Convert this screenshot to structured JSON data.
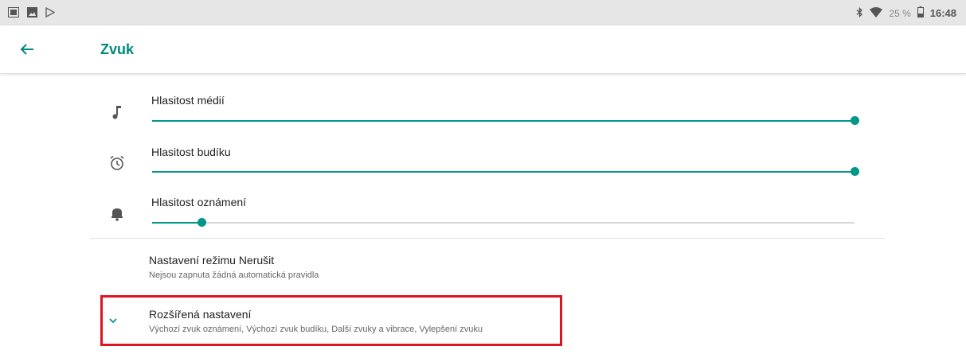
{
  "status_bar": {
    "left_icons": [
      "gallery-icon",
      "image-icon",
      "play-store-icon"
    ],
    "right_icons": [
      "bluetooth-icon",
      "wifi-icon",
      "battery-icon"
    ],
    "battery_percent": "25 %",
    "time": "16:48"
  },
  "app_bar": {
    "title": "Zvuk",
    "back_icon": "arrow-back-icon"
  },
  "volumes": [
    {
      "label": "Hlasitost médií",
      "icon": "music-note-icon",
      "level": 1.0
    },
    {
      "label": "Hlasitost budíku",
      "icon": "alarm-icon",
      "level": 1.0
    },
    {
      "label": "Hlasitost oznámení",
      "icon": "bell-icon",
      "level": 0.07
    }
  ],
  "items": [
    {
      "title": "Nastavení režimu Nerušit",
      "subtitle": "Nejsou zapnuta žádná automatická pravidla"
    },
    {
      "title": "Rozšířená nastavení",
      "subtitle": "Výchozí zvuk oznámení, Výchozí zvuk budíku, Další zvuky a vibrace, Vylepšení zvuku",
      "icon": "chevron-down-icon"
    }
  ],
  "colors": {
    "accent": "#009688",
    "highlight": "#e0141e"
  }
}
